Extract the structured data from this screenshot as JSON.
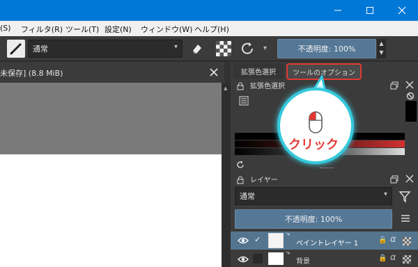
{
  "menubar": {
    "items": [
      "(S)",
      "フィルタ(R)",
      "ツール(T)",
      "設定(N)",
      "ウィンドウ(W)",
      "ヘルプ(H)"
    ]
  },
  "toolbar": {
    "blend_mode": "通常",
    "opacity_label": "不透明度: 100%"
  },
  "document": {
    "tab_title": "未保存] (8.8 MiB)"
  },
  "dock": {
    "tabs": [
      "拡張色選択",
      "ツールのオプション"
    ],
    "color_panel_title": "拡張色選択",
    "layers_panel_title": "レイヤー",
    "layers_blend_mode": "通常",
    "layers_opacity_label": "不透明度: 100%",
    "layers": [
      {
        "name": "ペイントレイヤー 1",
        "selected": true
      },
      {
        "name": "背景",
        "selected": false
      }
    ]
  },
  "annotation": {
    "label": "クリック",
    "highlight_color": "#e53935",
    "callout_color": "#35c9dc"
  },
  "colors": {
    "titlebar": "#0078d7",
    "accent_button": "#557896"
  }
}
